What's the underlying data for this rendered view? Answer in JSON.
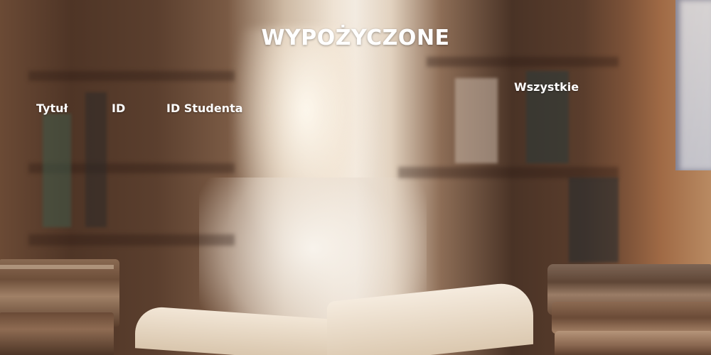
{
  "page": {
    "title": "WYPOŻYCZONE"
  },
  "filter": {
    "label": "Wszystkie"
  },
  "table": {
    "columns": [
      "Tytuł",
      "ID",
      "ID Studenta"
    ]
  },
  "theme": {
    "text_color": "#ffffff",
    "background": "blurred library bookshelf photo"
  }
}
